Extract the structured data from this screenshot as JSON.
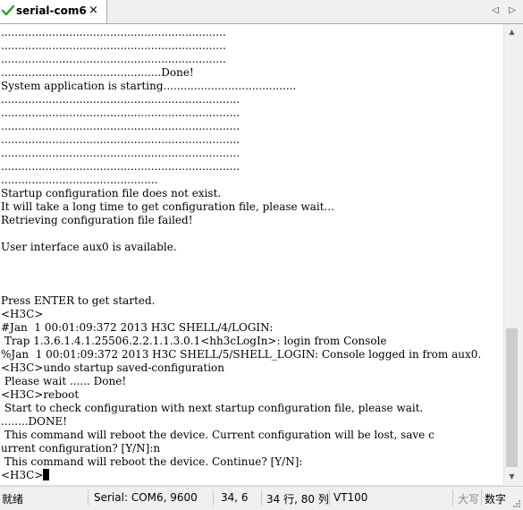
{
  "tab": {
    "title": "serial-com6",
    "close": "×"
  },
  "nav": {
    "prev": "◁",
    "next": "▷"
  },
  "terminal": {
    "lines": [
      "..................................................................",
      "..................................................................",
      "..................................................................",
      "...............................................Done!",
      "System application is starting.......................................",
      "......................................................................",
      "......................................................................",
      "......................................................................",
      "......................................................................",
      "......................................................................",
      "......................................................................",
      "..............................................",
      "Startup configuration file does not exist.",
      "It will take a long time to get configuration file, please wait...",
      "Retrieving configuration file failed!",
      "",
      "User interface aux0 is available.",
      "",
      "",
      "",
      "Press ENTER to get started.",
      "<H3C>",
      "#Jan  1 00:01:09:372 2013 H3C SHELL/4/LOGIN:",
      " Trap 1.3.6.1.4.1.25506.2.2.1.1.3.0.1<hh3cLogIn>: login from Console",
      "%Jan  1 00:01:09:372 2013 H3C SHELL/5/SHELL_LOGIN: Console logged in from aux0.",
      "<H3C>undo startup saved-configuration",
      " Please wait ...... Done!",
      "<H3C>reboot",
      " Start to check configuration with next startup configuration file, please wait.",
      "........DONE!",
      " This command will reboot the device. Current configuration will be lost, save c",
      "urrent configuration? [Y/N]:n",
      " This command will reboot the device. Continue? [Y/N]:",
      "<H3C>"
    ]
  },
  "status": {
    "ready": "就绪",
    "port": "Serial: COM6, 9600",
    "cursor_pos": "34,   6",
    "dims": "34 行, 80 列",
    "term_type": "VT100",
    "caps": "大写",
    "num": "数字"
  }
}
